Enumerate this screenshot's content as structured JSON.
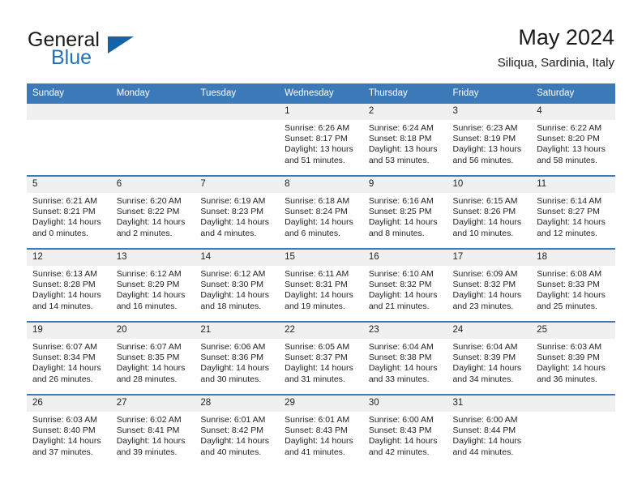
{
  "brand": {
    "name_part1": "General",
    "name_part2": "Blue",
    "accent_color": "#1263a8"
  },
  "header": {
    "title": "May 2024",
    "subtitle": "Siliqua, Sardinia, Italy"
  },
  "theme": {
    "header_blue": "#3b79b8",
    "daynum_band": "#f0f0f0",
    "text": "#1f1f1f"
  },
  "weekdays": [
    "Sunday",
    "Monday",
    "Tuesday",
    "Wednesday",
    "Thursday",
    "Friday",
    "Saturday"
  ],
  "weeks": [
    [
      {
        "day": "",
        "empty": true
      },
      {
        "day": "",
        "empty": true
      },
      {
        "day": "",
        "empty": true
      },
      {
        "day": "1",
        "sunrise": "Sunrise: 6:26 AM",
        "sunset": "Sunset: 8:17 PM",
        "daylight1": "Daylight: 13 hours",
        "daylight2": "and 51 minutes."
      },
      {
        "day": "2",
        "sunrise": "Sunrise: 6:24 AM",
        "sunset": "Sunset: 8:18 PM",
        "daylight1": "Daylight: 13 hours",
        "daylight2": "and 53 minutes."
      },
      {
        "day": "3",
        "sunrise": "Sunrise: 6:23 AM",
        "sunset": "Sunset: 8:19 PM",
        "daylight1": "Daylight: 13 hours",
        "daylight2": "and 56 minutes."
      },
      {
        "day": "4",
        "sunrise": "Sunrise: 6:22 AM",
        "sunset": "Sunset: 8:20 PM",
        "daylight1": "Daylight: 13 hours",
        "daylight2": "and 58 minutes."
      }
    ],
    [
      {
        "day": "5",
        "sunrise": "Sunrise: 6:21 AM",
        "sunset": "Sunset: 8:21 PM",
        "daylight1": "Daylight: 14 hours",
        "daylight2": "and 0 minutes."
      },
      {
        "day": "6",
        "sunrise": "Sunrise: 6:20 AM",
        "sunset": "Sunset: 8:22 PM",
        "daylight1": "Daylight: 14 hours",
        "daylight2": "and 2 minutes."
      },
      {
        "day": "7",
        "sunrise": "Sunrise: 6:19 AM",
        "sunset": "Sunset: 8:23 PM",
        "daylight1": "Daylight: 14 hours",
        "daylight2": "and 4 minutes."
      },
      {
        "day": "8",
        "sunrise": "Sunrise: 6:18 AM",
        "sunset": "Sunset: 8:24 PM",
        "daylight1": "Daylight: 14 hours",
        "daylight2": "and 6 minutes."
      },
      {
        "day": "9",
        "sunrise": "Sunrise: 6:16 AM",
        "sunset": "Sunset: 8:25 PM",
        "daylight1": "Daylight: 14 hours",
        "daylight2": "and 8 minutes."
      },
      {
        "day": "10",
        "sunrise": "Sunrise: 6:15 AM",
        "sunset": "Sunset: 8:26 PM",
        "daylight1": "Daylight: 14 hours",
        "daylight2": "and 10 minutes."
      },
      {
        "day": "11",
        "sunrise": "Sunrise: 6:14 AM",
        "sunset": "Sunset: 8:27 PM",
        "daylight1": "Daylight: 14 hours",
        "daylight2": "and 12 minutes."
      }
    ],
    [
      {
        "day": "12",
        "sunrise": "Sunrise: 6:13 AM",
        "sunset": "Sunset: 8:28 PM",
        "daylight1": "Daylight: 14 hours",
        "daylight2": "and 14 minutes."
      },
      {
        "day": "13",
        "sunrise": "Sunrise: 6:12 AM",
        "sunset": "Sunset: 8:29 PM",
        "daylight1": "Daylight: 14 hours",
        "daylight2": "and 16 minutes."
      },
      {
        "day": "14",
        "sunrise": "Sunrise: 6:12 AM",
        "sunset": "Sunset: 8:30 PM",
        "daylight1": "Daylight: 14 hours",
        "daylight2": "and 18 minutes."
      },
      {
        "day": "15",
        "sunrise": "Sunrise: 6:11 AM",
        "sunset": "Sunset: 8:31 PM",
        "daylight1": "Daylight: 14 hours",
        "daylight2": "and 19 minutes."
      },
      {
        "day": "16",
        "sunrise": "Sunrise: 6:10 AM",
        "sunset": "Sunset: 8:32 PM",
        "daylight1": "Daylight: 14 hours",
        "daylight2": "and 21 minutes."
      },
      {
        "day": "17",
        "sunrise": "Sunrise: 6:09 AM",
        "sunset": "Sunset: 8:32 PM",
        "daylight1": "Daylight: 14 hours",
        "daylight2": "and 23 minutes."
      },
      {
        "day": "18",
        "sunrise": "Sunrise: 6:08 AM",
        "sunset": "Sunset: 8:33 PM",
        "daylight1": "Daylight: 14 hours",
        "daylight2": "and 25 minutes."
      }
    ],
    [
      {
        "day": "19",
        "sunrise": "Sunrise: 6:07 AM",
        "sunset": "Sunset: 8:34 PM",
        "daylight1": "Daylight: 14 hours",
        "daylight2": "and 26 minutes."
      },
      {
        "day": "20",
        "sunrise": "Sunrise: 6:07 AM",
        "sunset": "Sunset: 8:35 PM",
        "daylight1": "Daylight: 14 hours",
        "daylight2": "and 28 minutes."
      },
      {
        "day": "21",
        "sunrise": "Sunrise: 6:06 AM",
        "sunset": "Sunset: 8:36 PM",
        "daylight1": "Daylight: 14 hours",
        "daylight2": "and 30 minutes."
      },
      {
        "day": "22",
        "sunrise": "Sunrise: 6:05 AM",
        "sunset": "Sunset: 8:37 PM",
        "daylight1": "Daylight: 14 hours",
        "daylight2": "and 31 minutes."
      },
      {
        "day": "23",
        "sunrise": "Sunrise: 6:04 AM",
        "sunset": "Sunset: 8:38 PM",
        "daylight1": "Daylight: 14 hours",
        "daylight2": "and 33 minutes."
      },
      {
        "day": "24",
        "sunrise": "Sunrise: 6:04 AM",
        "sunset": "Sunset: 8:39 PM",
        "daylight1": "Daylight: 14 hours",
        "daylight2": "and 34 minutes."
      },
      {
        "day": "25",
        "sunrise": "Sunrise: 6:03 AM",
        "sunset": "Sunset: 8:39 PM",
        "daylight1": "Daylight: 14 hours",
        "daylight2": "and 36 minutes."
      }
    ],
    [
      {
        "day": "26",
        "sunrise": "Sunrise: 6:03 AM",
        "sunset": "Sunset: 8:40 PM",
        "daylight1": "Daylight: 14 hours",
        "daylight2": "and 37 minutes."
      },
      {
        "day": "27",
        "sunrise": "Sunrise: 6:02 AM",
        "sunset": "Sunset: 8:41 PM",
        "daylight1": "Daylight: 14 hours",
        "daylight2": "and 39 minutes."
      },
      {
        "day": "28",
        "sunrise": "Sunrise: 6:01 AM",
        "sunset": "Sunset: 8:42 PM",
        "daylight1": "Daylight: 14 hours",
        "daylight2": "and 40 minutes."
      },
      {
        "day": "29",
        "sunrise": "Sunrise: 6:01 AM",
        "sunset": "Sunset: 8:43 PM",
        "daylight1": "Daylight: 14 hours",
        "daylight2": "and 41 minutes."
      },
      {
        "day": "30",
        "sunrise": "Sunrise: 6:00 AM",
        "sunset": "Sunset: 8:43 PM",
        "daylight1": "Daylight: 14 hours",
        "daylight2": "and 42 minutes."
      },
      {
        "day": "31",
        "sunrise": "Sunrise: 6:00 AM",
        "sunset": "Sunset: 8:44 PM",
        "daylight1": "Daylight: 14 hours",
        "daylight2": "and 44 minutes."
      },
      {
        "day": "",
        "empty": true
      }
    ]
  ]
}
